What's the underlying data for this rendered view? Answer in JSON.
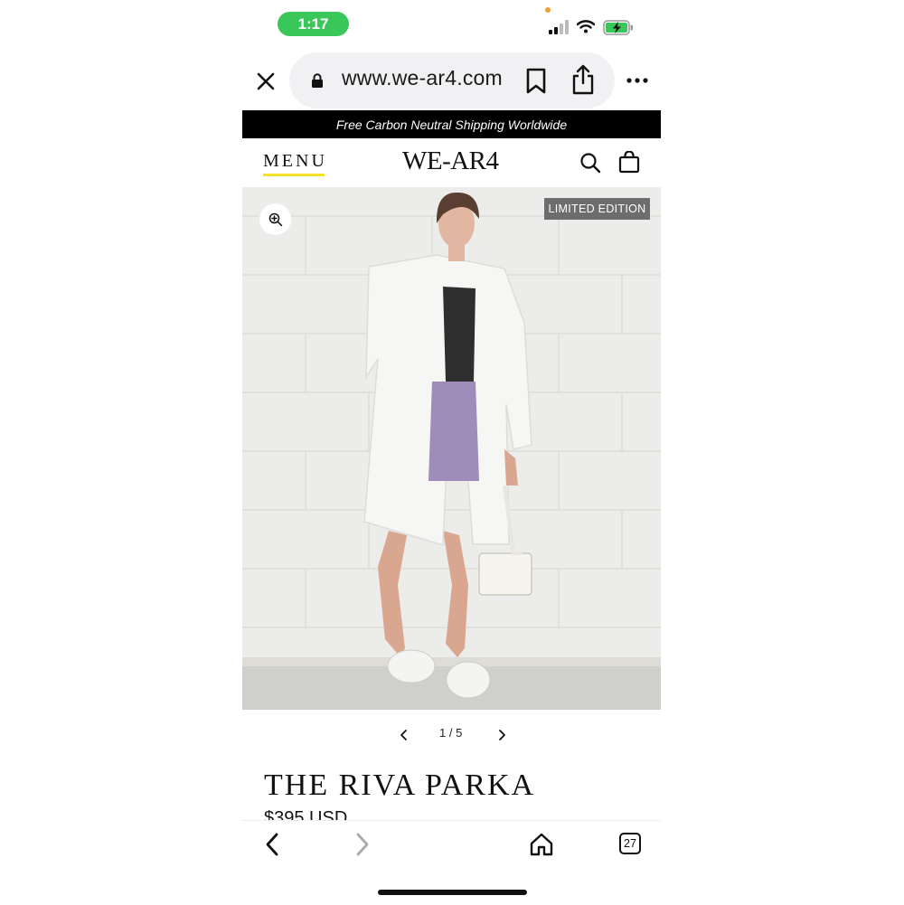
{
  "status_bar": {
    "time": "1:17",
    "accent": "#3ac75a"
  },
  "browser": {
    "url": "www.we-ar4.com",
    "icons": [
      "close-icon",
      "lock-icon",
      "bookmark-icon",
      "share-icon",
      "more-icon"
    ]
  },
  "site": {
    "promo": "Free Carbon Neutral Shipping Worldwide",
    "menu_label": "MENU",
    "logo": "WE-AR4",
    "menu_underline_color": "#f4e027"
  },
  "product": {
    "badge": "LIMITED EDITION",
    "pager": "1 / 5",
    "title": "THE RIVA PARKA",
    "price": "$395 USD"
  },
  "toolbar": {
    "tab_count": "27"
  }
}
